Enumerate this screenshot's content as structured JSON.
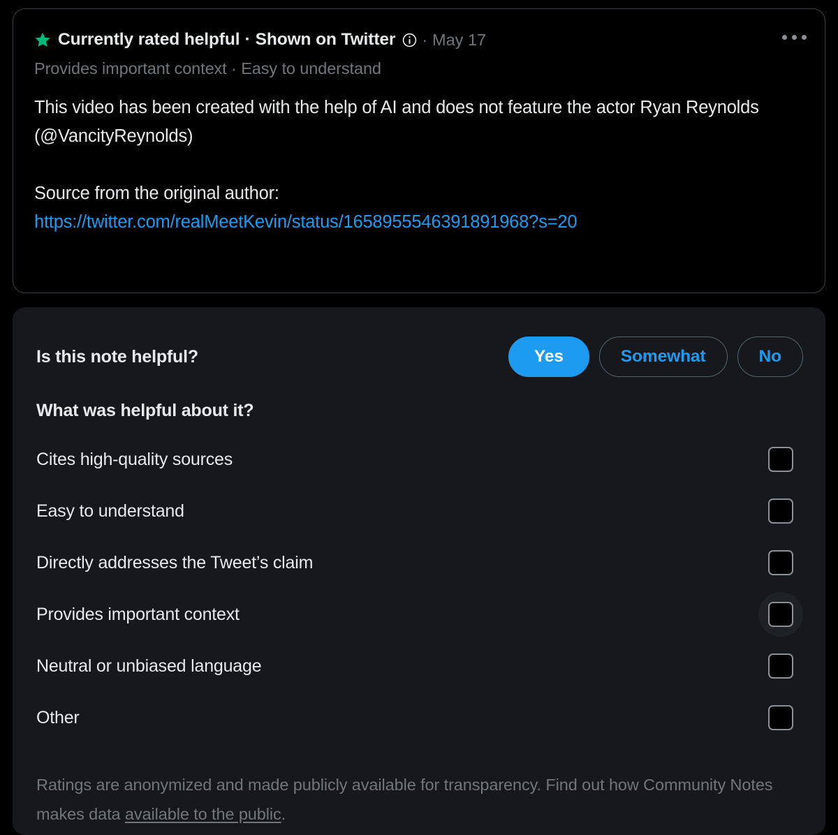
{
  "note_card": {
    "star_icon": "star-icon",
    "status_label": "Currently rated helpful",
    "separator": "·",
    "shown_label": "Shown on Twitter",
    "info_icon": "info-circle-icon",
    "date": "May 17",
    "more_icon": "more-horizontal-icon",
    "subtitle": "Provides important context · Easy to understand",
    "body_line_1": "This video has been created with the help of AI and does not feature the actor Ryan Reynolds (@VancityReynolds)",
    "body_line_2": "Source from the original author:",
    "link_text": "https://twitter.com/realMeetKevin/status/1658955546391891968?s=20"
  },
  "rating_panel": {
    "helpful_question": "Is this note helpful?",
    "options": [
      {
        "label": "Yes",
        "selected": true
      },
      {
        "label": "Somewhat",
        "selected": false
      },
      {
        "label": "No",
        "selected": false
      }
    ],
    "sub_question": "What was helpful about it?",
    "checkboxes": [
      {
        "label": "Cites high-quality sources",
        "checked": false,
        "hovered": false
      },
      {
        "label": "Easy to understand",
        "checked": false,
        "hovered": false
      },
      {
        "label": "Directly addresses the Tweet’s claim",
        "checked": false,
        "hovered": false
      },
      {
        "label": "Provides important context",
        "checked": false,
        "hovered": true
      },
      {
        "label": "Neutral or unbiased language",
        "checked": false,
        "hovered": false
      },
      {
        "label": "Other",
        "checked": false,
        "hovered": false
      }
    ],
    "footer_text_before": "Ratings are anonymized and made publicly available for transparency. Find out how Community Notes makes data ",
    "footer_link": "available to the public",
    "footer_text_after": "."
  },
  "colors": {
    "background": "#000000",
    "panel_background": "#16181c",
    "accent_blue": "#1d9bf0",
    "star_green": "#00ba7c",
    "text_primary": "#e7e9ea",
    "text_secondary": "#71767b",
    "border": "#3b4046"
  }
}
